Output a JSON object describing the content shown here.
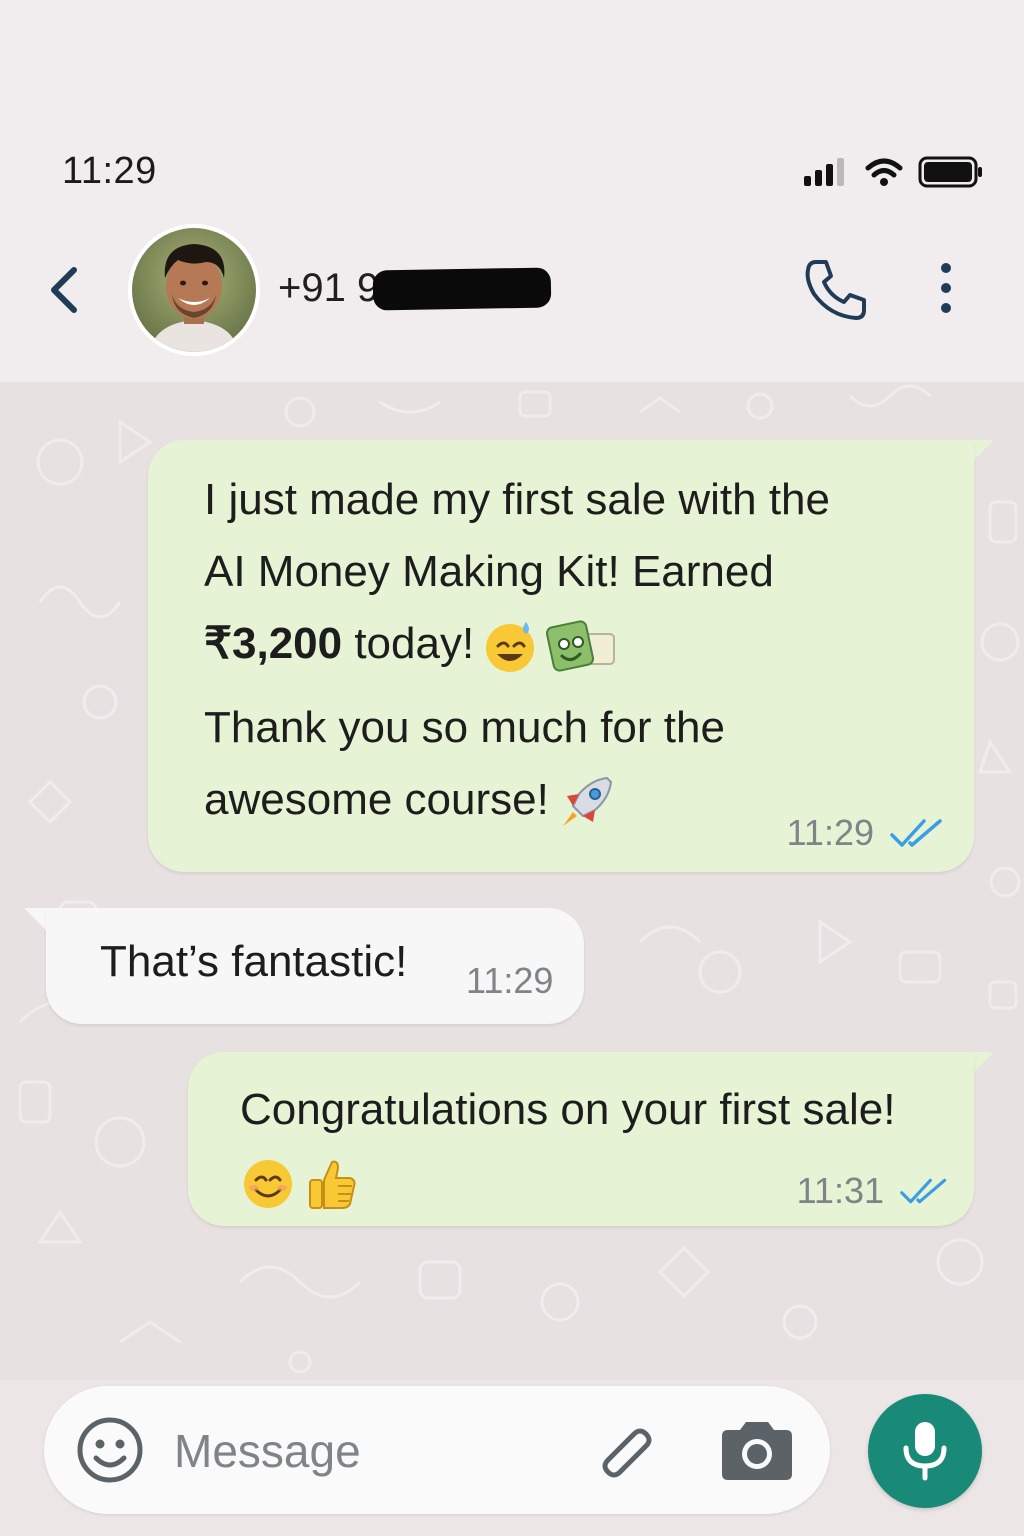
{
  "status_bar": {
    "time": "11:29"
  },
  "header": {
    "contact_name": "+91 9"
  },
  "messages": [
    {
      "direction": "outgoing",
      "text_a1": "I just made my first sale with the\nAI Money Making Kit! Earned\n",
      "amount": "₹3,200",
      "text_a2": " today!",
      "text_b": "Thank you so much for the\nawesome course!",
      "time": "11:29",
      "ticks": "read"
    },
    {
      "direction": "incoming",
      "text": "That’s fantastic!",
      "time": "11:29"
    },
    {
      "direction": "outgoing",
      "text": "Congratulations on your first sale!",
      "time": "11:31",
      "ticks": "read"
    }
  ],
  "input_bar": {
    "placeholder": "Message"
  },
  "colors": {
    "outgoing_bubble": "#e6f3d4",
    "incoming_bubble": "#f8f7f7",
    "read_ticks": "#3b9ee4",
    "mic_button": "#1a8a78",
    "header_icons": "#1f3b57"
  },
  "icons": {
    "back": "chevron-left-icon",
    "call": "phone-icon",
    "menu": "kebab-menu-icon",
    "emoji": "smiley-icon",
    "attach": "paperclip-icon",
    "camera": "camera-icon",
    "mic": "microphone-icon"
  }
}
